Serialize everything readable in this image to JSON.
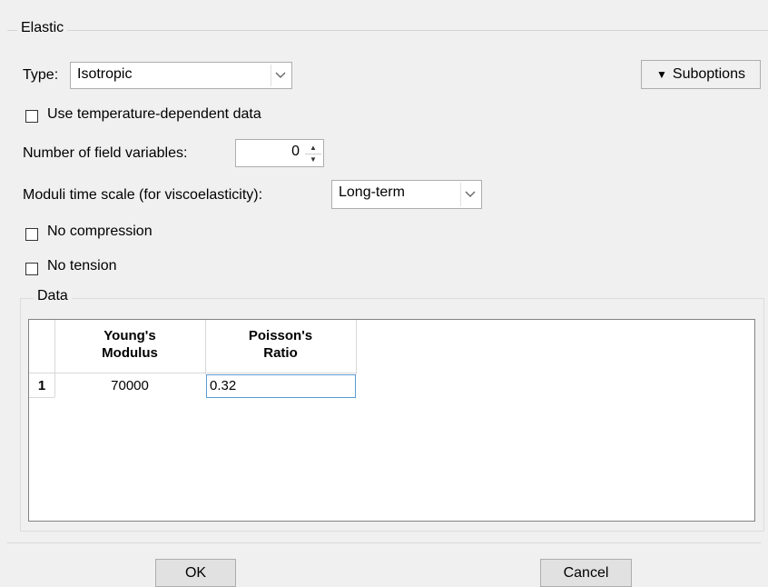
{
  "elastic": {
    "title": "Elastic",
    "type_label": "Type:",
    "type_value": "Isotropic",
    "suboptions_label": "Suboptions",
    "temp_dependent_label": "Use temperature-dependent data",
    "field_vars_label": "Number of field variables:",
    "field_vars_value": "0",
    "moduli_label": "Moduli time scale (for viscoelasticity):",
    "moduli_value": "Long-term",
    "no_compression_label": "No compression",
    "no_tension_label": "No tension"
  },
  "data": {
    "title": "Data",
    "columns": [
      {
        "line1": "Young's",
        "line2": "Modulus"
      },
      {
        "line1": "Poisson's",
        "line2": "Ratio"
      }
    ],
    "rows": [
      {
        "index": "1",
        "young": "70000",
        "poisson": "0.32"
      }
    ]
  },
  "buttons": {
    "ok": "OK",
    "cancel": "Cancel"
  }
}
